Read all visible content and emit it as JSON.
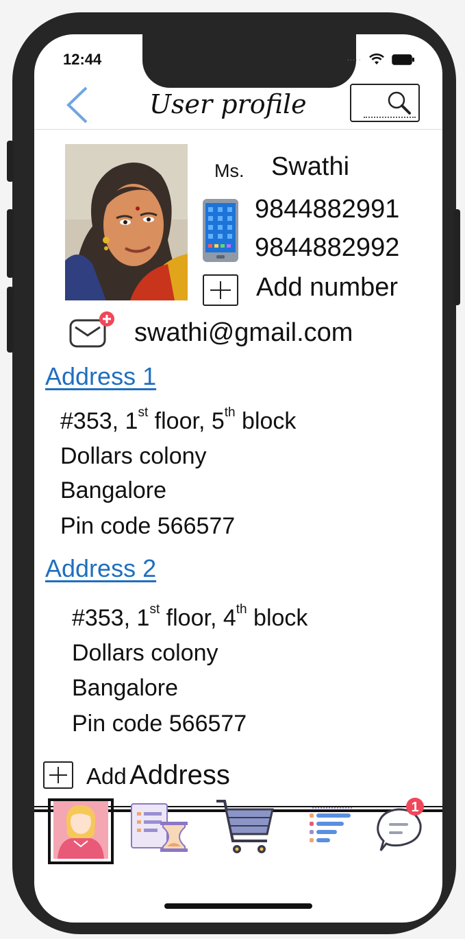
{
  "status": {
    "time": "12:44"
  },
  "header": {
    "title": "User profile"
  },
  "profile": {
    "prefix": "Ms.",
    "name": "Swathi",
    "phones": [
      "9844882991",
      "9844882992"
    ],
    "add_number_label": "Add number",
    "email": "swathi@gmail.com"
  },
  "addresses": [
    {
      "title": "Address 1",
      "line1": {
        "a": "#353, 1",
        "sup1": "st",
        "b": " floor, 5",
        "sup2": "th",
        "c": " block"
      },
      "line2": "Dollars colony",
      "line3": "Bangalore",
      "line4": "Pin code 566577"
    },
    {
      "title": "Address 2",
      "line1": {
        "a": "#353, 1",
        "sup1": "st",
        "b": " floor, 4",
        "sup2": "th",
        "c": " block"
      },
      "line2": "Dollars colony",
      "line3": "Bangalore",
      "line4": "Pin code 566577"
    }
  ],
  "add_address": {
    "word1": "Add",
    "word2": "Address"
  },
  "nav": {
    "items": [
      "profile-icon",
      "order-history-icon",
      "cart-icon",
      "list-filter-icon",
      "chat-icon"
    ],
    "selected": "profile-icon",
    "chat_badge": "1"
  },
  "colors": {
    "link": "#1f6fbf",
    "back": "#6fa6e0",
    "badge": "#f0475a",
    "avatar_bg": "#f4a7b2"
  }
}
